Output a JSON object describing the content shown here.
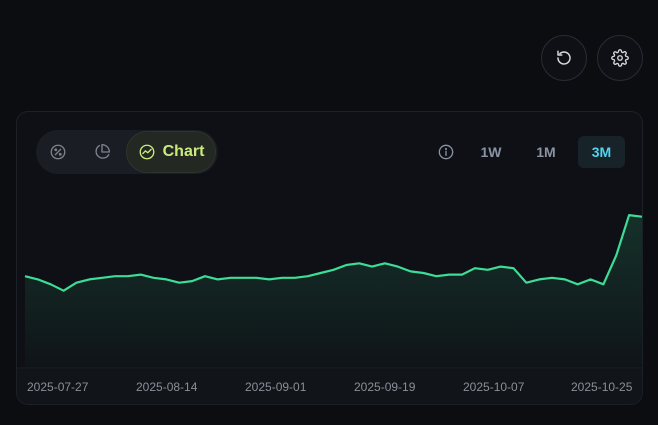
{
  "toolbar": {
    "reset_icon": "reset-icon",
    "settings_icon": "gear-icon"
  },
  "view_toggle": {
    "options": [
      {
        "icon": "percent-icon"
      },
      {
        "icon": "pie-chart-icon"
      },
      {
        "icon": "trend-chart-icon",
        "label": "Chart",
        "selected": true
      }
    ]
  },
  "time_range": {
    "info_icon": "info-icon",
    "options": [
      {
        "label": "1W",
        "selected": false
      },
      {
        "label": "1M",
        "selected": false
      },
      {
        "label": "3M",
        "selected": true
      }
    ]
  },
  "colors": {
    "accent_line": "#3ddc97",
    "chart_toggle_text": "#c9ec7c",
    "selected_range_text": "#4fd5f0"
  },
  "chart_data": {
    "type": "area",
    "x_tick_labels": [
      "2025-07-27",
      "2025-08-14",
      "2025-09-01",
      "2025-09-19",
      "2025-10-07",
      "2025-10-25"
    ],
    "x_start": "2025-07-27",
    "x_end": "2025-10-27",
    "values": [
      57,
      55,
      52,
      48,
      53,
      55,
      56,
      57,
      57,
      58,
      56,
      55,
      53,
      54,
      57,
      55,
      56,
      56,
      56,
      55,
      56,
      56,
      57,
      59,
      61,
      64,
      65,
      63,
      65,
      63,
      60,
      59,
      57,
      58,
      58,
      62,
      61,
      63,
      62,
      53,
      55,
      56,
      55,
      52,
      55,
      52,
      70,
      95,
      94
    ],
    "grid": false,
    "legend": "none"
  }
}
